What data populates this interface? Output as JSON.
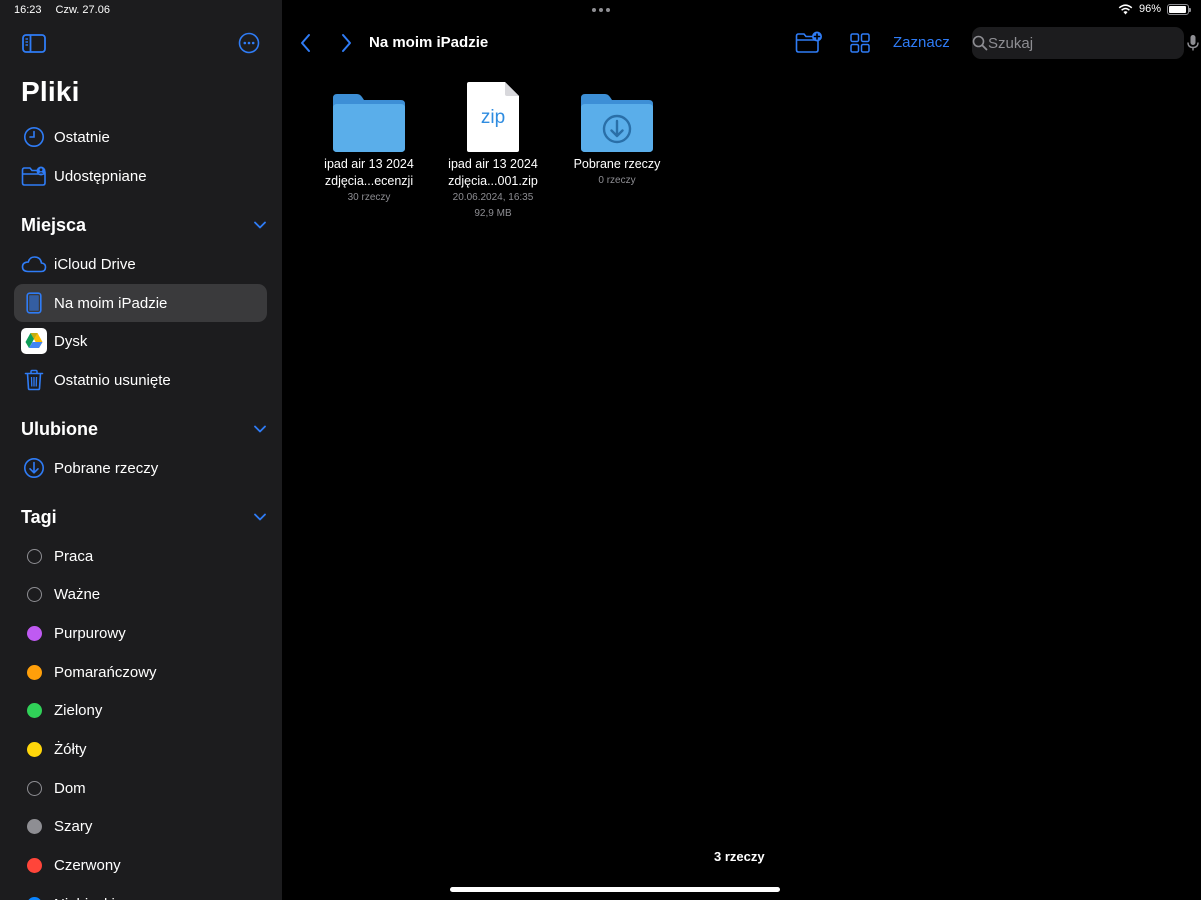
{
  "status": {
    "time": "16:23",
    "date": "Czw. 27.06",
    "battery": "96%",
    "battery_level": 0.96
  },
  "sidebar": {
    "title": "Pliki",
    "top_items": [
      {
        "label": "Ostatnie",
        "icon": "clock-icon"
      },
      {
        "label": "Udostępniane",
        "icon": "shared-folder-icon"
      }
    ],
    "places": {
      "title": "Miejsca",
      "items": [
        {
          "label": "iCloud Drive",
          "icon": "cloud-icon"
        },
        {
          "label": "Na moim iPadzie",
          "icon": "ipad-icon",
          "active": true
        },
        {
          "label": "Dysk",
          "icon": "google-drive-icon"
        },
        {
          "label": "Ostatnio usunięte",
          "icon": "trash-icon"
        }
      ]
    },
    "favorites": {
      "title": "Ulubione",
      "items": [
        {
          "label": "Pobrane rzeczy",
          "icon": "download-circle-icon"
        }
      ]
    },
    "tags": {
      "title": "Tagi",
      "items": [
        {
          "label": "Praca",
          "color": ""
        },
        {
          "label": "Ważne",
          "color": ""
        },
        {
          "label": "Purpurowy",
          "color": "#bf5af2"
        },
        {
          "label": "Pomarańczowy",
          "color": "#ff9f0a"
        },
        {
          "label": "Zielony",
          "color": "#30d158"
        },
        {
          "label": "Żółty",
          "color": "#ffd60a"
        },
        {
          "label": "Dom",
          "color": ""
        },
        {
          "label": "Szary",
          "color": "#8e8e93"
        },
        {
          "label": "Czerwony",
          "color": "#ff453a"
        },
        {
          "label": "Niebieski",
          "color": "#0a84ff"
        }
      ]
    }
  },
  "toolbar": {
    "title": "Na moim iPadzie",
    "select_label": "Zaznacz",
    "search_placeholder": "Szukaj"
  },
  "files": [
    {
      "name_line1": "ipad air 13 2024",
      "name_line2": "zdjęcia...ecenzji",
      "meta1": "30 rzeczy",
      "meta2": "",
      "type": "folder"
    },
    {
      "name_line1": "ipad air 13 2024",
      "name_line2": "zdjęcia...001.zip",
      "meta1": "20.06.2024, 16:35",
      "meta2": "92,9 MB",
      "type": "zip",
      "badge": "zip"
    },
    {
      "name_line1": "Pobrane rzeczy",
      "name_line2": "",
      "meta1": "0 rzeczy",
      "meta2": "",
      "type": "downloads-folder"
    }
  ],
  "footer": {
    "count": "3 rzeczy"
  },
  "colors": {
    "accent": "#2f7cf6",
    "folder": "#5aa9e6"
  }
}
